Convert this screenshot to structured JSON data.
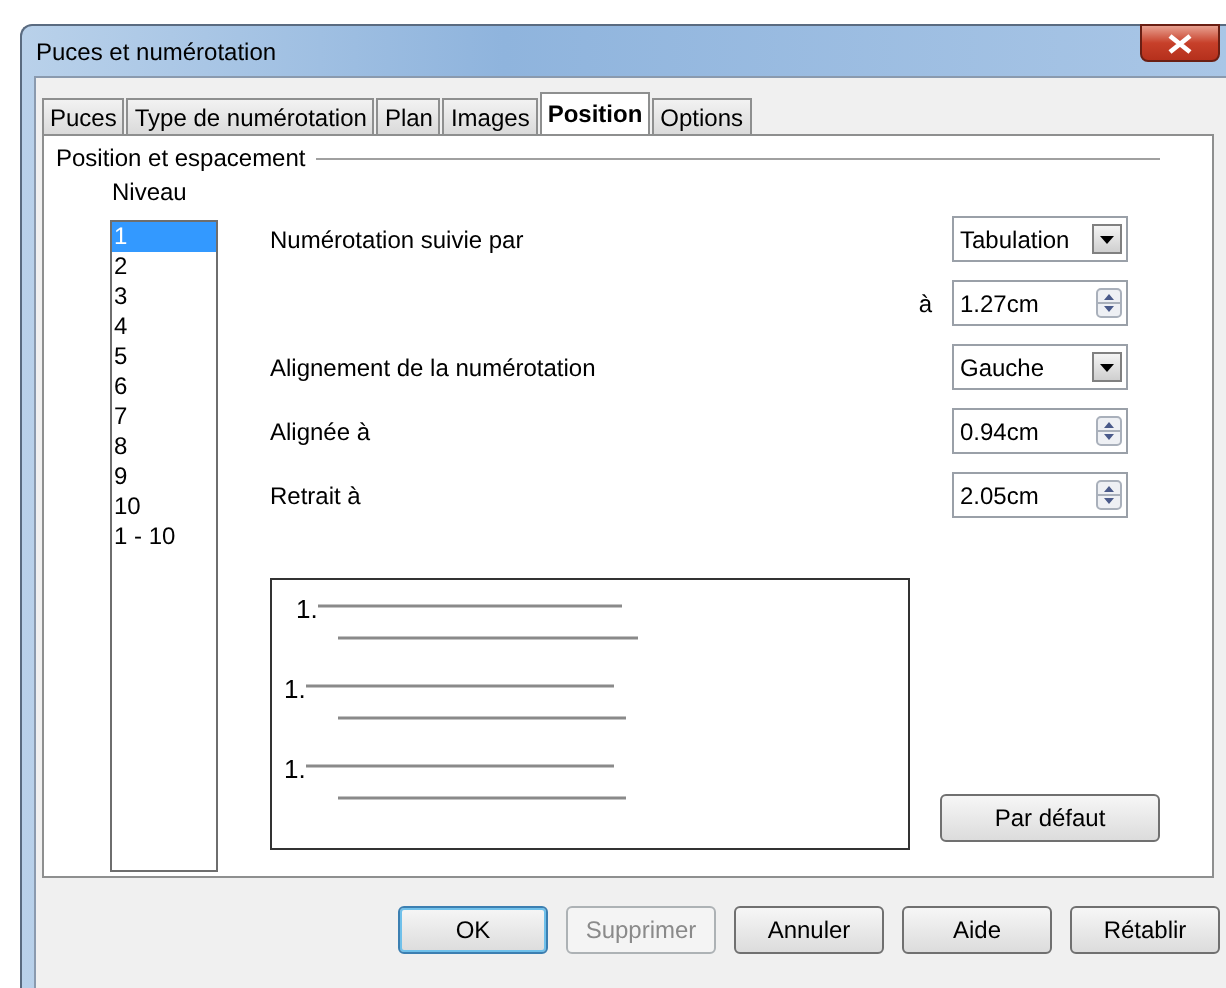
{
  "window": {
    "title": "Puces et numérotation"
  },
  "tabs": [
    {
      "label": "Puces",
      "selected": false
    },
    {
      "label": "Type de numérotation",
      "selected": false
    },
    {
      "label": "Plan",
      "selected": false
    },
    {
      "label": "Images",
      "selected": false
    },
    {
      "label": "Position",
      "selected": true
    },
    {
      "label": "Options",
      "selected": false
    }
  ],
  "group": {
    "title": "Position et espacement"
  },
  "level_list": {
    "label": "Niveau",
    "items": [
      {
        "label": "1",
        "selected": true
      },
      {
        "label": "2",
        "selected": false
      },
      {
        "label": "3",
        "selected": false
      },
      {
        "label": "4",
        "selected": false
      },
      {
        "label": "5",
        "selected": false
      },
      {
        "label": "6",
        "selected": false
      },
      {
        "label": "7",
        "selected": false
      },
      {
        "label": "8",
        "selected": false
      },
      {
        "label": "9",
        "selected": false
      },
      {
        "label": "10",
        "selected": false
      },
      {
        "label": "1 - 10",
        "selected": false
      }
    ]
  },
  "settings": [
    {
      "label": "Numérotation suivie par",
      "kind": "dropdown",
      "value": "Tabulation"
    },
    {
      "prefix": "à",
      "kind": "spin",
      "value": "1.27cm"
    },
    {
      "label": "Alignement de la numérotation",
      "kind": "dropdown",
      "value": "Gauche"
    },
    {
      "label": "Alignée à",
      "kind": "spin",
      "value": "0.94cm"
    },
    {
      "label": "Retrait à",
      "kind": "spin",
      "value": "2.05cm"
    }
  ],
  "preview": {
    "items": [
      "1.",
      "1.",
      "1."
    ]
  },
  "default_button": "Par défaut",
  "buttons": [
    {
      "label": "OK",
      "default": true,
      "disabled": false
    },
    {
      "label": "Supprimer",
      "default": false,
      "disabled": true
    },
    {
      "label": "Annuler",
      "default": false,
      "disabled": false
    },
    {
      "label": "Aide",
      "default": false,
      "disabled": false
    },
    {
      "label": "Rétablir",
      "default": false,
      "disabled": false
    }
  ]
}
